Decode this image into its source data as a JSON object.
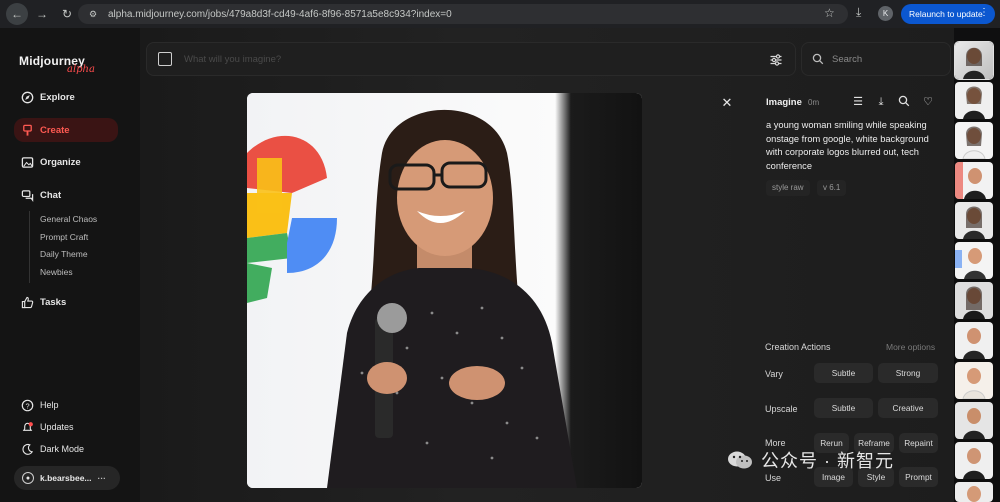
{
  "browser": {
    "url": "alpha.midjourney.com/jobs/479a8d3f-cd49-4af6-8f96-8571a5e8c934?index=0",
    "profile_initial": "K",
    "relaunch_label": "Relaunch to update"
  },
  "logo": {
    "name": "Midjourney",
    "tag": "alpha"
  },
  "sidebar": {
    "items": [
      {
        "label": "Explore",
        "icon": "compass-icon"
      },
      {
        "label": "Create",
        "icon": "brush-icon",
        "active": true
      },
      {
        "label": "Organize",
        "icon": "image-icon"
      },
      {
        "label": "Chat",
        "icon": "chat-icon"
      },
      {
        "label": "Tasks",
        "icon": "thumbs-up-icon"
      }
    ],
    "chat_rooms": [
      "General Chaos",
      "Prompt Craft",
      "Daily Theme",
      "Newbies"
    ],
    "footer": [
      {
        "label": "Help",
        "icon": "help-icon"
      },
      {
        "label": "Updates",
        "icon": "bell-icon"
      },
      {
        "label": "Dark Mode",
        "icon": "moon-icon"
      }
    ],
    "user": {
      "name": "k.bearsbee...",
      "menu": "···"
    }
  },
  "prompt_bar": {
    "placeholder": "What will you imagine?"
  },
  "search": {
    "placeholder": "Search"
  },
  "detail": {
    "title": "Imagine",
    "time": "0m",
    "prompt": "a young woman smiling while speaking onstage from google, white background with corporate logos blurred out, tech conference",
    "tags": [
      "style raw",
      "v 6.1"
    ]
  },
  "creation_actions": {
    "title": "Creation Actions",
    "more_options": "More options",
    "rows": [
      {
        "label": "Vary",
        "buttons": [
          "Subtle",
          "Strong"
        ]
      },
      {
        "label": "Upscale",
        "buttons": [
          "Subtle",
          "Creative"
        ]
      },
      {
        "label": "More",
        "buttons": [
          "Rerun",
          "Reframe",
          "Repaint"
        ]
      },
      {
        "label": "Use",
        "buttons": [
          "Image",
          "Style",
          "Prompt"
        ]
      }
    ]
  },
  "watermark": {
    "text": "公众号 · 新智元"
  },
  "colors": {
    "accent": "#ff5a52",
    "relaunch": "#0b57d0",
    "background": "#141414"
  }
}
